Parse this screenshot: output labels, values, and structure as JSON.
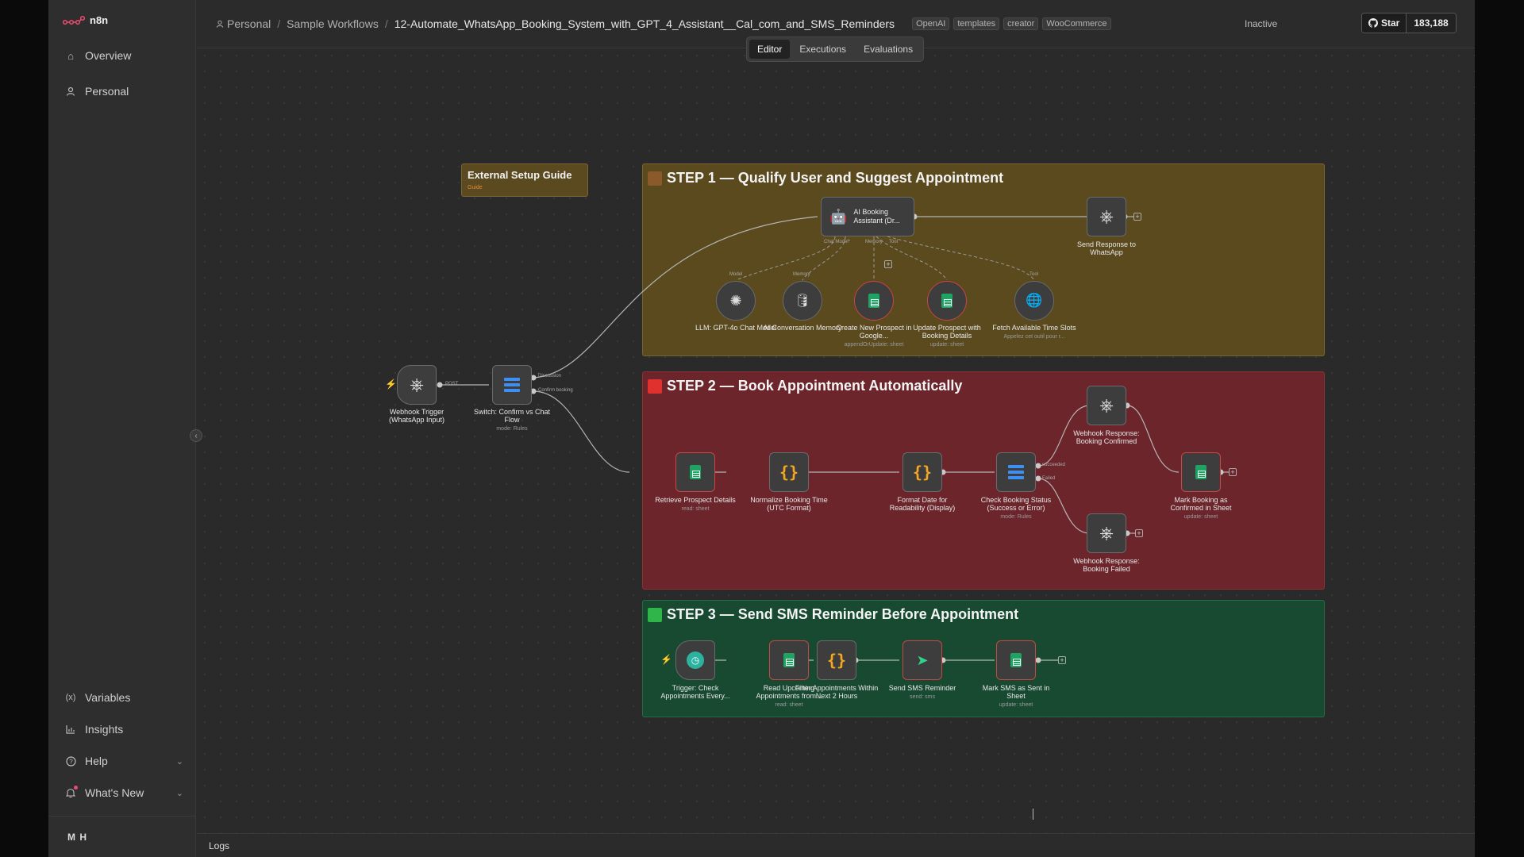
{
  "app": {
    "brand": "n8n",
    "user_initials": "M H"
  },
  "sidebar": {
    "overview": "Overview",
    "personal": "Personal",
    "variables": "Variables",
    "insights": "Insights",
    "help": "Help",
    "whats_new": "What's New"
  },
  "header": {
    "crumb_project": "Personal",
    "crumb_folder": "Sample Workflows",
    "crumb_workflow": "12-Automate_WhatsApp_Booking_System_with_GPT_4_Assistant__Cal_com_and_SMS_Reminders",
    "tags": [
      "OpenAI",
      "templates",
      "creator",
      "WooCommerce"
    ],
    "status": "Inactive",
    "github_star": "Star",
    "github_count": "183,188"
  },
  "tabs": {
    "editor": "Editor",
    "executions": "Executions",
    "evaluations": "Evaluations"
  },
  "canvas": {
    "guide_title": "External Setup Guide",
    "guide_sub": "Guide",
    "step1_title": "STEP 1 — Qualify User and Suggest Appointment",
    "step2_title": "STEP 2 — Book Appointment Automatically",
    "step3_title": "STEP 3 — Send SMS Reminder Before Appointment",
    "colors": {
      "step1": "#5a4a1e",
      "step2": "#6b252b",
      "step3": "#184a32"
    },
    "nodes": {
      "ai_agent": "AI Booking Assistant (Dr...",
      "ai_agent_ports": [
        "Chat Model*",
        "Memory",
        "Tool"
      ],
      "send_resp": "Send Response to WhatsApp",
      "llm": "LLM: GPT-4o Chat Model",
      "llm_port": "Model",
      "memory": "AI Conversation Memory",
      "memory_port": "Memory",
      "create_prospect": "Create New Prospect in Google...",
      "create_prospect_sub": "appendOrUpdate: sheet",
      "update_prospect": "Update Prospect with Booking Details",
      "update_prospect_sub": "update: sheet",
      "fetch_slots": "Fetch Available Time Slots",
      "fetch_slots_sub": "Appelez cet outil pour r...",
      "fetch_slots_port": "Tool",
      "webhook": "Webhook Trigger (WhatsApp Input)",
      "webhook_port": "POST",
      "switch": "Switch: Confirm vs Chat Flow",
      "switch_sub": "mode: Rules",
      "switch_out1": "Discussion",
      "switch_out2": "Confirm booking",
      "retrieve": "Retrieve Prospect Details",
      "retrieve_sub": "read: sheet",
      "normalize": "Normalize Booking Time (UTC Format)",
      "format_date": "Format Date for Readability (Display)",
      "check_status": "Check Booking Status (Success or Error)",
      "check_status_sub": "mode: Rules",
      "check_out1": "succeeded",
      "check_out2": "Failed",
      "resp_confirmed": "Webhook Response: Booking Confirmed",
      "resp_failed": "Webhook Response: Booking Failed",
      "mark_confirmed": "Mark Booking as Confirmed in Sheet",
      "mark_confirmed_sub": "update: sheet",
      "trigger_check": "Trigger: Check Appointments Every...",
      "read_upcoming": "Read Upcoming Appointments from...",
      "read_upcoming_sub": "read: sheet",
      "filter": "Filter Appointments Within Next 2 Hours",
      "send_sms": "Send SMS Reminder",
      "send_sms_sub": "send: sms",
      "mark_sent": "Mark SMS as Sent in Sheet",
      "mark_sent_sub": "update: sheet"
    }
  },
  "logs": {
    "label": "Logs"
  }
}
